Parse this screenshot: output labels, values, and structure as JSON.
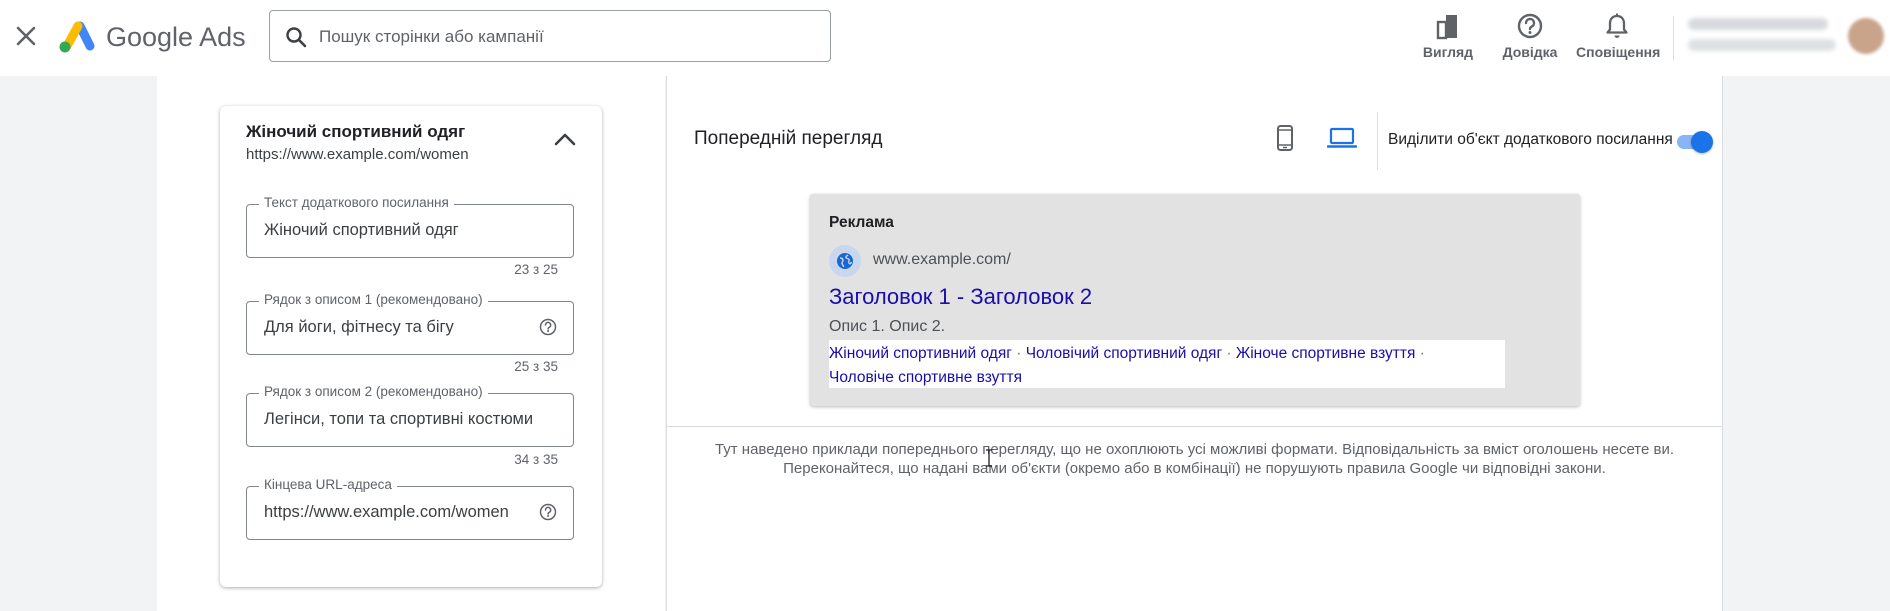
{
  "app": {
    "brand_google": "Google",
    "brand_ads": "Ads"
  },
  "search": {
    "placeholder": "Пошук сторінки або кампанії"
  },
  "toolbar": {
    "view_label": "Вигляд",
    "help_label": "Довідка",
    "notifications_label": "Сповіщення"
  },
  "sitelink_card": {
    "title": "Жіночий спортивний одяг",
    "url": "https://www.example.com/women",
    "fields": [
      {
        "label": "Текст додаткового посилання",
        "value": "Жіночий спортивний одяг",
        "counter": "23 з 25"
      },
      {
        "label": "Рядок з описом 1 (рекомендовано)",
        "value": "Для йоги, фітнесу та бігу",
        "counter": "25 з 35"
      },
      {
        "label": "Рядок з описом 2 (рекомендовано)",
        "value": "Легінси, топи та спортивні костюми",
        "counter": "34 з 35"
      },
      {
        "label": "Кінцева URL-адреса",
        "value": "https://www.example.com/women"
      }
    ]
  },
  "preview": {
    "title": "Попередній перегляд",
    "highlight_label": "Виділити об'єкт додаткового посилання",
    "highlight_on": true,
    "ad": {
      "label": "Реклама",
      "display_url": "www.example.com/",
      "headline": "Заголовок 1 - Заголовок 2",
      "description": "Опис 1. Опис 2.",
      "separator": "·",
      "sitelinks": [
        "Жіночий спортивний одяг",
        "Чоловічий спортивний одяг",
        "Жіноче спортивне взуття",
        "Чоловіче спортивне взуття"
      ]
    },
    "disclaimer_line1": "Тут наведено приклади попереднього перегляду, що не охоплюють усі можливі формати. Відповідальність за вміст оголошень несете ви.",
    "disclaimer_line2": "Переконайтеся, що надані вами об'єкти (окремо або в комбінації) не порушують правила Google чи відповідні закони."
  },
  "colors": {
    "accent": "#1a73e8",
    "link": "#1a0dab",
    "toggle_track": "#8ab4f8"
  }
}
